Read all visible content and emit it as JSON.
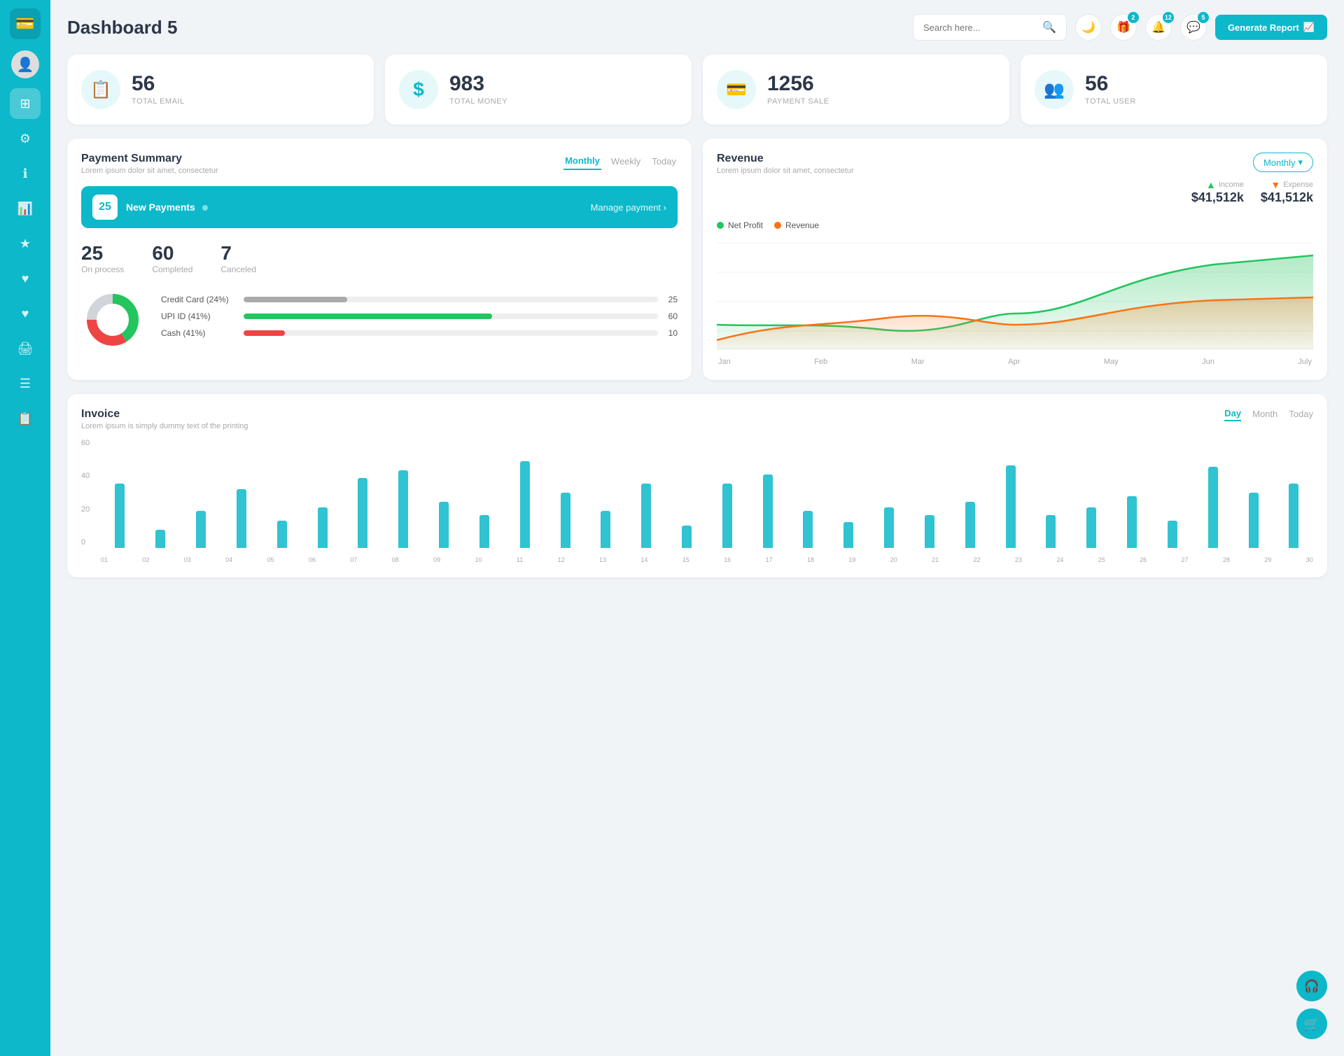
{
  "app": {
    "title": "Dashboard 5"
  },
  "sidebar": {
    "items": [
      {
        "id": "logo",
        "icon": "💳",
        "label": "logo"
      },
      {
        "id": "avatar",
        "icon": "👤",
        "label": "avatar"
      },
      {
        "id": "dashboard",
        "icon": "⊞",
        "label": "dashboard",
        "active": true
      },
      {
        "id": "settings",
        "icon": "⚙",
        "label": "settings"
      },
      {
        "id": "info",
        "icon": "ℹ",
        "label": "info"
      },
      {
        "id": "chart",
        "icon": "📊",
        "label": "chart"
      },
      {
        "id": "star",
        "icon": "★",
        "label": "star"
      },
      {
        "id": "heart",
        "icon": "♥",
        "label": "heart"
      },
      {
        "id": "heart2",
        "icon": "♥",
        "label": "heart2"
      },
      {
        "id": "print",
        "icon": "🖨",
        "label": "print"
      },
      {
        "id": "menu",
        "icon": "☰",
        "label": "menu"
      },
      {
        "id": "list",
        "icon": "📋",
        "label": "list"
      }
    ]
  },
  "header": {
    "title": "Dashboard 5",
    "search_placeholder": "Search here...",
    "generate_btn": "Generate Report",
    "icons": {
      "moon": "🌙",
      "gift": "🎁",
      "bell": "🔔",
      "chat": "💬"
    },
    "badges": {
      "gift": "2",
      "bell": "12",
      "chat": "5"
    }
  },
  "stat_cards": [
    {
      "id": "email",
      "icon": "📋",
      "num": "56",
      "label": "TOTAL EMAIL"
    },
    {
      "id": "money",
      "icon": "$",
      "num": "983",
      "label": "TOTAL MONEY"
    },
    {
      "id": "payment",
      "icon": "💳",
      "num": "1256",
      "label": "PAYMENT SALE"
    },
    {
      "id": "user",
      "icon": "👥",
      "num": "56",
      "label": "TOTAL USER"
    }
  ],
  "payment_summary": {
    "title": "Payment Summary",
    "subtitle": "Lorem ipsum dolor sit amet, consectetur",
    "tabs": [
      "Monthly",
      "Weekly",
      "Today"
    ],
    "active_tab": "Monthly",
    "new_payments_count": "25",
    "new_payments_label": "New Payments",
    "manage_link": "Manage payment",
    "stats": [
      {
        "num": "25",
        "label": "On process"
      },
      {
        "num": "60",
        "label": "Completed"
      },
      {
        "num": "7",
        "label": "Canceled"
      }
    ],
    "progress_rows": [
      {
        "label": "Credit Card (24%)",
        "value": 25,
        "color": "#aaa",
        "display": "25"
      },
      {
        "label": "UPI ID (41%)",
        "value": 60,
        "color": "#22c55e",
        "display": "60"
      },
      {
        "label": "Cash (41%)",
        "value": 10,
        "color": "#ef4444",
        "display": "10"
      }
    ],
    "donut": {
      "segments": [
        {
          "pct": 25,
          "color": "#ddd"
        },
        {
          "pct": 41,
          "color": "#22c55e"
        },
        {
          "pct": 34,
          "color": "#ef4444"
        }
      ]
    }
  },
  "revenue": {
    "title": "Revenue",
    "subtitle": "Lorem ipsum dolor sit amet, consectetur",
    "dropdown_label": "Monthly",
    "income_label": "Income",
    "income_val": "$41,512k",
    "expense_label": "Expense",
    "expense_val": "$41,512k",
    "legend": [
      {
        "label": "Net Profit",
        "color": "#22c55e"
      },
      {
        "label": "Revenue",
        "color": "#f97316"
      }
    ],
    "x_labels": [
      "Jan",
      "Feb",
      "Mar",
      "Apr",
      "May",
      "Jun",
      "July"
    ],
    "y_labels": [
      "0",
      "30",
      "60",
      "90",
      "120"
    ],
    "chart": {
      "net_profit": [
        28,
        25,
        30,
        22,
        40,
        80,
        95
      ],
      "revenue": [
        10,
        30,
        25,
        35,
        28,
        50,
        55
      ]
    }
  },
  "invoice": {
    "title": "Invoice",
    "subtitle": "Lorem ipsum is simply dummy text of the printing",
    "tabs": [
      "Day",
      "Month",
      "Today"
    ],
    "active_tab": "Day",
    "y_labels": [
      "0",
      "20",
      "40",
      "60"
    ],
    "x_labels": [
      "01",
      "02",
      "03",
      "04",
      "05",
      "06",
      "07",
      "08",
      "09",
      "10",
      "11",
      "12",
      "13",
      "14",
      "15",
      "16",
      "17",
      "18",
      "19",
      "20",
      "21",
      "22",
      "23",
      "24",
      "25",
      "26",
      "27",
      "28",
      "29",
      "30"
    ],
    "bars": [
      35,
      10,
      20,
      32,
      15,
      22,
      38,
      42,
      25,
      18,
      47,
      30,
      20,
      35,
      12,
      35,
      40,
      20,
      14,
      22,
      18,
      25,
      45,
      18,
      22,
      28,
      15,
      44,
      30,
      35
    ]
  },
  "fab": {
    "support_icon": "🎧",
    "cart_icon": "🛒"
  }
}
